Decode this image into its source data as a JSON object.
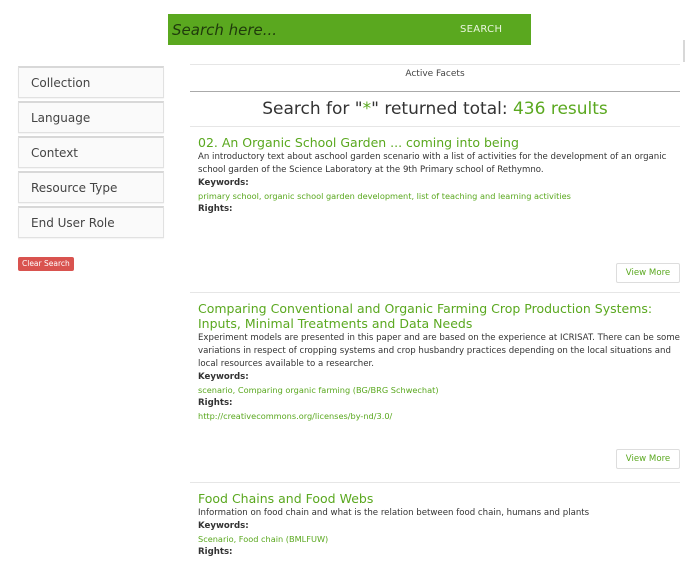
{
  "search": {
    "placeholder": "Search here...",
    "button_label": "SEARCH"
  },
  "sidebar": {
    "facets": [
      {
        "label": "Collection"
      },
      {
        "label": "Language"
      },
      {
        "label": "Context"
      },
      {
        "label": "Resource Type"
      },
      {
        "label": "End User Role"
      }
    ],
    "clear_label": "Clear Search"
  },
  "main": {
    "active_facets_label": "Active Facets",
    "heading_prefix": "Search for \"",
    "query": "*",
    "heading_mid": "\" returned total: ",
    "total_count": "436 results"
  },
  "labels": {
    "keywords": "Keywords:",
    "rights": "Rights:",
    "view_more": "View More"
  },
  "results": [
    {
      "title": "02. An Organic School Garden ... coming into being",
      "description": "An introductory text about aschool garden scenario with a list of activities for the development of an organic school garden of the Science Laboratory at the 9th Primary school of Rethymno.",
      "keywords": "primary school, organic school garden development, list of teaching and learning activities",
      "rights": ""
    },
    {
      "title": "Comparing Conventional and Organic Farming Crop Production Systems: Inputs, Minimal Treatments and Data Needs",
      "description": "Experiment models are presented in this paper and are based on the experience at ICRISAT. There can be some variations in respect of cropping systems and crop husbandry practices depending on the local situations and local resources available to a researcher.",
      "keywords": "scenario, Comparing organic farming (BG/BRG Schwechat)",
      "rights": "http://creativecommons.org/licenses/by-nd/3.0/"
    },
    {
      "title": "Food Chains and Food Webs",
      "description": "Information on food chain and what is the relation between food chain, humans and plants",
      "keywords": "Scenario, Food chain (BMLFUW)",
      "rights": ""
    }
  ],
  "colors": {
    "accent": "#5aa81f",
    "danger": "#d9534f"
  }
}
